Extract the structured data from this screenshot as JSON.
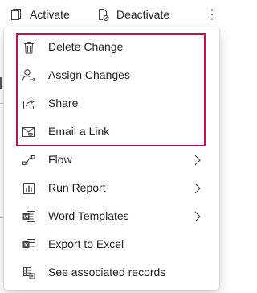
{
  "toolbar": {
    "activate_label": "Activate",
    "activate_icon": "activate-icon",
    "deactivate_label": "Deactivate",
    "deactivate_icon": "deactivate-icon",
    "more_label": "⋮"
  },
  "menu": {
    "highlight_color": "#b8134f",
    "items": [
      {
        "label": "Delete Change",
        "icon": "trash-icon",
        "has_submenu": false
      },
      {
        "label": "Assign Changes",
        "icon": "assign-user-icon",
        "has_submenu": false
      },
      {
        "label": "Share",
        "icon": "share-icon",
        "has_submenu": false
      },
      {
        "label": "Email a Link",
        "icon": "email-link-icon",
        "has_submenu": false
      },
      {
        "label": "Flow",
        "icon": "flow-icon",
        "has_submenu": true
      },
      {
        "label": "Run Report",
        "icon": "report-icon",
        "has_submenu": true
      },
      {
        "label": "Word Templates",
        "icon": "word-icon",
        "has_submenu": true
      },
      {
        "label": "Export to Excel",
        "icon": "excel-icon",
        "has_submenu": false
      },
      {
        "label": "See associated records",
        "icon": "associated-records-icon",
        "has_submenu": false
      }
    ]
  }
}
